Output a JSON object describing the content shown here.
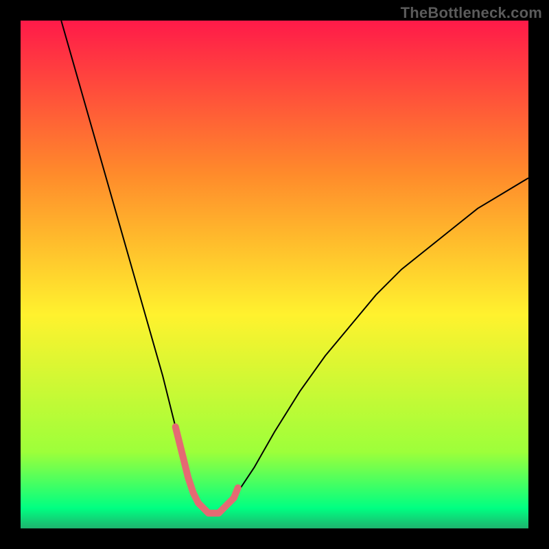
{
  "watermark": "TheBottleneck.com",
  "chart_data": {
    "type": "line",
    "title": "",
    "xlabel": "",
    "ylabel": "",
    "xlim": [
      0,
      100
    ],
    "ylim": [
      0,
      100
    ],
    "grid": false,
    "legend": false,
    "gradient_colors": {
      "top": "#ff1a49",
      "mid_upper": "#ff8a2b",
      "mid": "#fff22e",
      "lower": "#9dff3a",
      "bottom_band": "#00ff82",
      "bottom_edge": "#1db36e"
    },
    "series": [
      {
        "name": "bottleneck-curve",
        "color": "#000000",
        "width": 2,
        "x": [
          8,
          10,
          12,
          14,
          16,
          18,
          20,
          22,
          24,
          26,
          28,
          30,
          31,
          32,
          33,
          34,
          35,
          36,
          37,
          38,
          39,
          40,
          41,
          42,
          44,
          46,
          50,
          55,
          60,
          65,
          70,
          75,
          80,
          85,
          90,
          95,
          100
        ],
        "y": [
          100,
          93,
          86,
          79,
          72,
          65,
          58,
          51,
          44,
          37,
          30,
          22,
          18,
          14,
          10,
          7,
          5,
          4,
          3,
          3,
          3,
          4,
          5,
          6,
          9,
          12,
          19,
          27,
          34,
          40,
          46,
          51,
          55,
          59,
          63,
          66,
          69
        ]
      },
      {
        "name": "flat-segment-overlay",
        "color": "#e46a73",
        "width": 10,
        "linecap": "round",
        "x": [
          30.5,
          31,
          32,
          33,
          34,
          35,
          36,
          37,
          38,
          39,
          40,
          41,
          42,
          42.8
        ],
        "y": [
          20,
          18,
          14,
          10,
          7,
          5,
          4,
          3,
          3,
          3,
          4,
          5,
          6,
          8
        ]
      }
    ]
  }
}
